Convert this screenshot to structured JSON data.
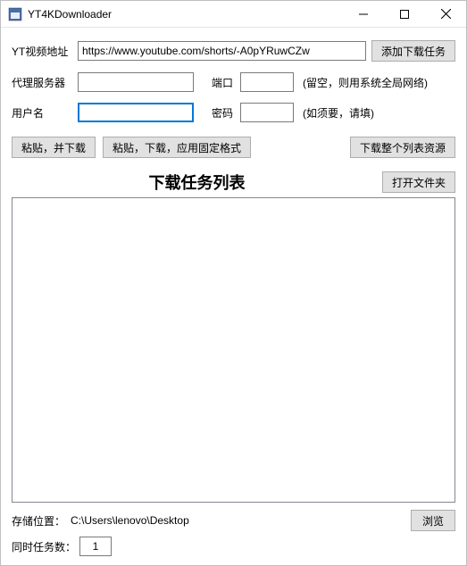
{
  "window": {
    "title": "YT4KDownloader"
  },
  "labels": {
    "url": "YT视频地址",
    "proxy": "代理服务器",
    "port": "端口",
    "proxy_hint": "(留空，则用系统全局网络)",
    "username": "用户名",
    "password": "密码",
    "auth_hint": "(如须要，请填)",
    "list_title": "下载任务列表",
    "save_path_label": "存储位置：",
    "save_path_value": "C:\\Users\\lenovo\\Desktop",
    "concurrent_label": "同时任务数："
  },
  "inputs": {
    "url": "https://www.youtube.com/shorts/-A0pYRuwCZw",
    "proxy": "",
    "port": "",
    "username": "",
    "password": "",
    "concurrent": "1"
  },
  "buttons": {
    "add_task": "添加下载任务",
    "paste_download": "粘贴，并下载",
    "paste_download_fixed": "粘贴，下载，应用固定格式",
    "download_playlist": "下载整个列表资源",
    "open_folder": "打开文件夹",
    "browse": "浏览"
  }
}
